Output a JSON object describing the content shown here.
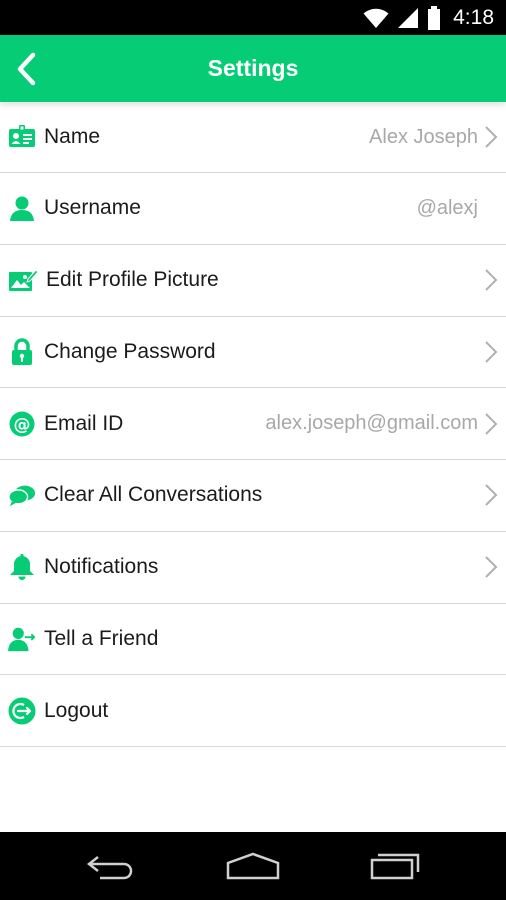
{
  "status_bar": {
    "time": "4:18"
  },
  "header": {
    "title": "Settings"
  },
  "settings": [
    {
      "label": "Name",
      "value": "Alex Joseph",
      "icon": "id-card-icon"
    },
    {
      "label": "Username",
      "value": "@alexj",
      "icon": "user-icon"
    },
    {
      "label": "Edit Profile Picture",
      "value": "",
      "icon": "edit-picture-icon"
    },
    {
      "label": "Change Password",
      "value": "",
      "icon": "lock-icon"
    },
    {
      "label": "Email ID",
      "value": "alex.joseph@gmail.com",
      "icon": "at-icon"
    },
    {
      "label": "Clear All Conversations",
      "value": "",
      "icon": "chat-bubbles-icon"
    },
    {
      "label": "Notifications",
      "value": "",
      "icon": "bell-icon"
    },
    {
      "label": "Tell a Friend",
      "value": "",
      "icon": "user-share-icon"
    },
    {
      "label": "Logout",
      "value": "",
      "icon": "logout-icon"
    }
  ],
  "colors": {
    "accent": "#06cd75",
    "value_text": "#a8a8a8",
    "divider": "#d8d8d8"
  }
}
